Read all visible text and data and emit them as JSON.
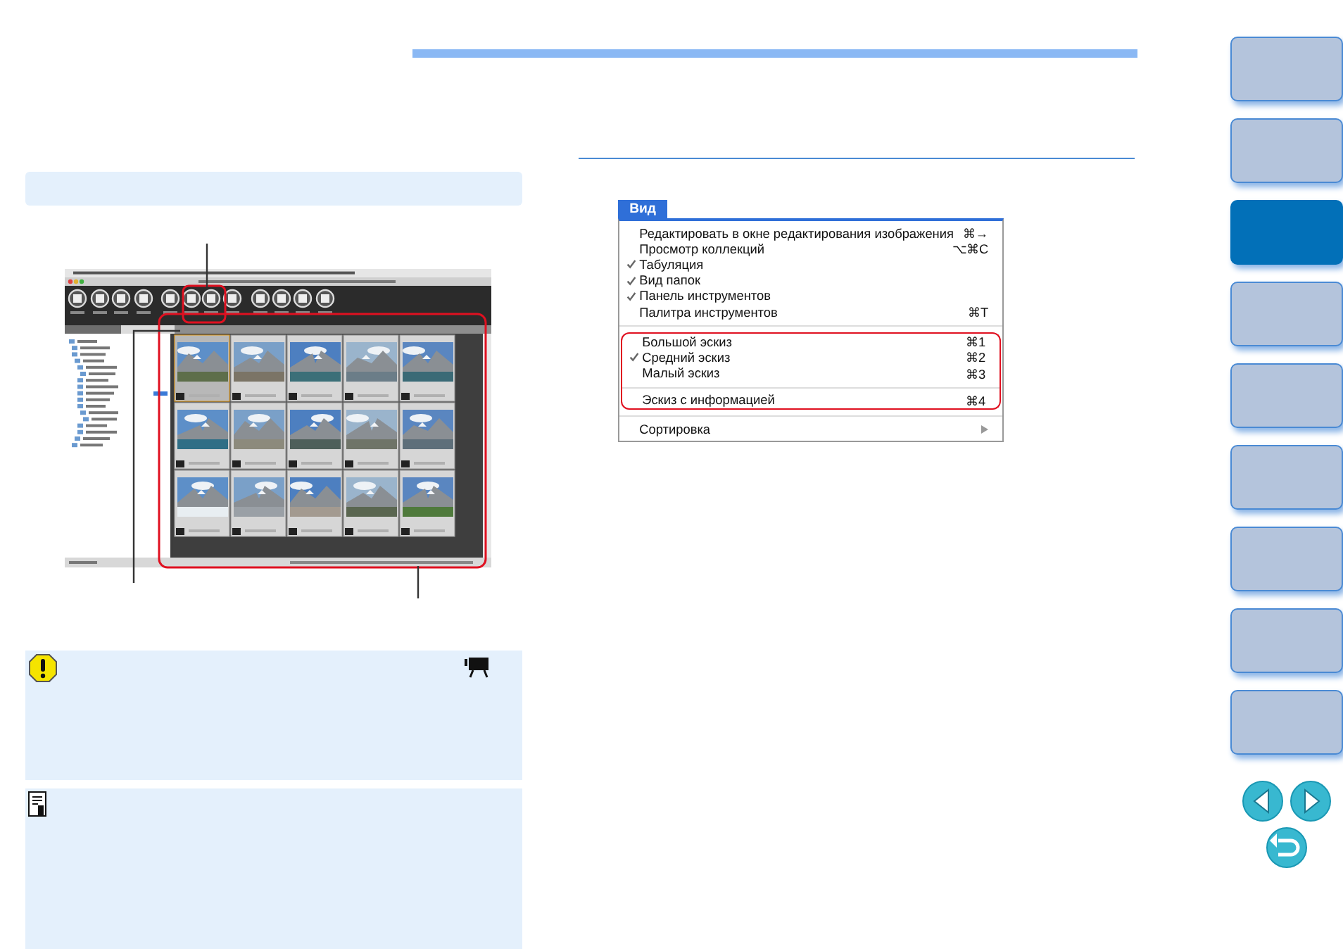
{
  "menu": {
    "title": "Вид",
    "groups": [
      {
        "highlighted": false,
        "items": [
          {
            "kind": "item",
            "label": "Редактировать в окне редактирования изображения",
            "shortcut": "⌘→",
            "checked": false
          },
          {
            "kind": "item",
            "label": "Просмотр коллекций",
            "shortcut": "⌥⌘C",
            "checked": false
          },
          {
            "kind": "item",
            "label": "Табуляция",
            "checked": true
          },
          {
            "kind": "item",
            "label": "Вид папок",
            "checked": true
          },
          {
            "kind": "item",
            "label": "Панель инструментов",
            "checked": true
          },
          {
            "kind": "item",
            "label": "Палитра инструментов",
            "shortcut": "⌘T",
            "checked": false
          }
        ]
      },
      {
        "highlighted": true,
        "items": [
          {
            "kind": "item",
            "label": "Большой эскиз",
            "shortcut": "⌘1",
            "checked": false
          },
          {
            "kind": "item",
            "label": "Средний эскиз",
            "shortcut": "⌘2",
            "checked": true
          },
          {
            "kind": "item",
            "label": "Малый эскиз",
            "shortcut": "⌘3",
            "checked": false
          }
        ]
      },
      {
        "highlighted": true,
        "items": [
          {
            "kind": "item",
            "label": "Эскиз с информацией",
            "shortcut": "⌘4",
            "checked": false
          }
        ]
      },
      {
        "highlighted": false,
        "items": [
          {
            "kind": "submenu",
            "label": "Сортировка",
            "checked": false
          }
        ]
      }
    ]
  },
  "notes": [
    {
      "kind": "warning"
    },
    {
      "kind": "tip"
    }
  ],
  "nav_tabs": [
    {
      "selected": false
    },
    {
      "selected": false
    },
    {
      "selected": true
    },
    {
      "selected": false
    },
    {
      "selected": false
    },
    {
      "selected": false
    },
    {
      "selected": false
    },
    {
      "selected": false
    },
    {
      "selected": false
    }
  ]
}
